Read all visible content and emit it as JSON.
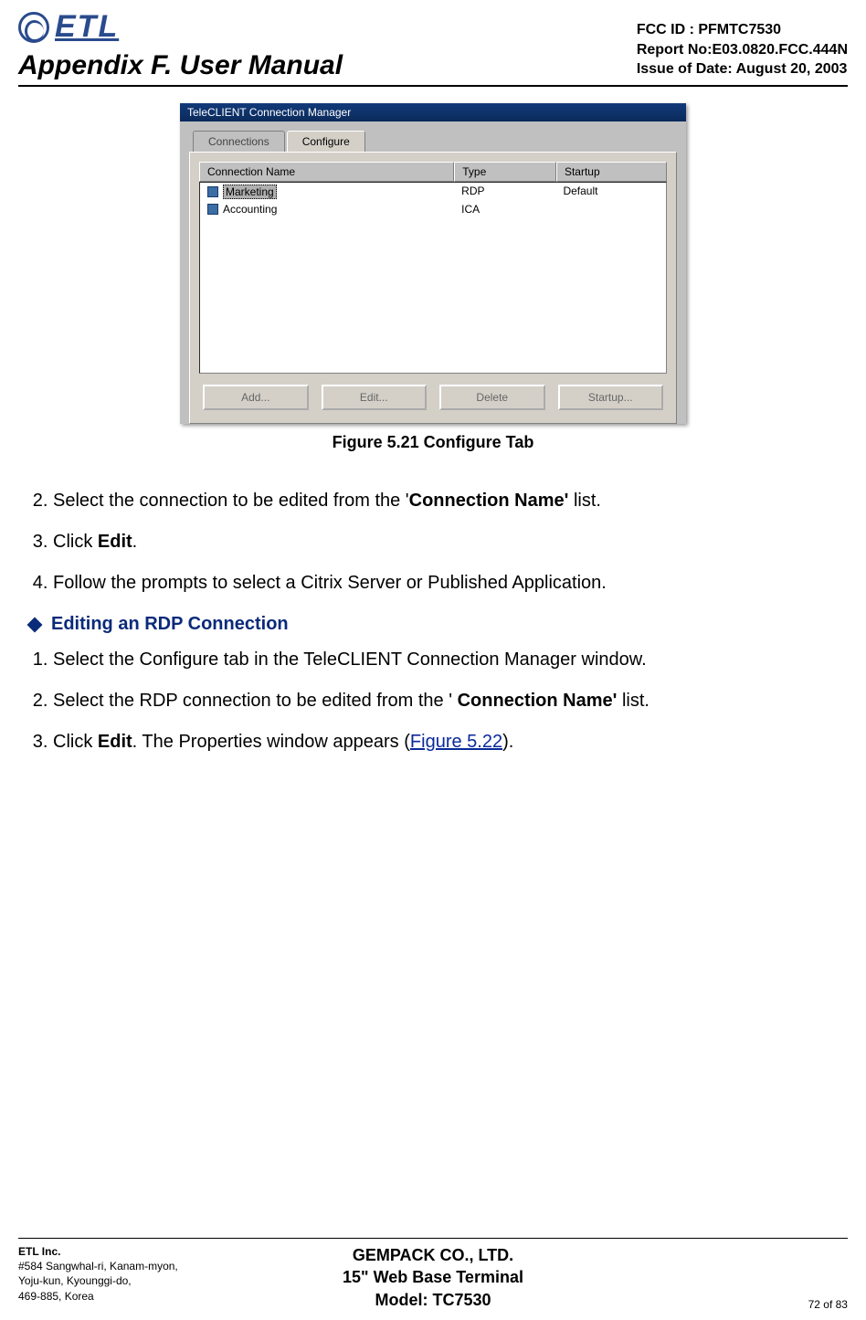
{
  "header": {
    "logo_text": "ETL",
    "appendix_title": "Appendix F. User Manual",
    "fcc_id": "FCC ID : PFMTC7530",
    "report_no": "Report No:E03.0820.FCC.444N",
    "issue_date": "Issue of Date: August 20, 2003"
  },
  "screenshot": {
    "title": "TeleCLIENT Connection Manager",
    "tabs": {
      "connections": "Connections",
      "configure": "Configure"
    },
    "columns": {
      "name": "Connection Name",
      "type": "Type",
      "startup": "Startup"
    },
    "rows": [
      {
        "name": "Marketing",
        "type": "RDP",
        "startup": "Default"
      },
      {
        "name": "Accounting",
        "type": "ICA",
        "startup": ""
      }
    ],
    "buttons": {
      "add": "Add...",
      "edit": "Edit...",
      "delete": "Delete",
      "startup": "Startup..."
    }
  },
  "figure_caption": "Figure 5.21    Configure Tab",
  "steps1": {
    "s2_pre": "Select the connection to be edited from the '",
    "s2_bold": "Connection Name'",
    "s2_post": "  list.",
    "s3_pre": "Click ",
    "s3_bold": "Edit",
    "s3_post": ".",
    "s4": "Follow the prompts to select a Citrix Server or Published Application."
  },
  "section_title": "Editing an RDP Connection",
  "steps2": {
    "s1": "Select the Configure tab in the TeleCLIENT Connection Manager window.",
    "s2_pre": "Select the RDP connection to be edited from the ' ",
    "s2_bold": "Connection Name'",
    "s2_post": "  list.",
    "s3_pre": "Click ",
    "s3_bold": "Edit",
    "s3_mid": ". The Properties window appears (",
    "s3_link": "Figure 5.22",
    "s3_post": ")."
  },
  "footer": {
    "company": "ETL Inc.",
    "addr1": "#584 Sangwhal-ri, Kanam-myon,",
    "addr2": "Yoju-kun, Kyounggi-do,",
    "addr3": "469-885, Korea",
    "center1": "GEMPACK CO., LTD.",
    "center2": "15\" Web Base Terminal",
    "center3": "Model: TC7530",
    "pagenum": "72 of 83"
  }
}
